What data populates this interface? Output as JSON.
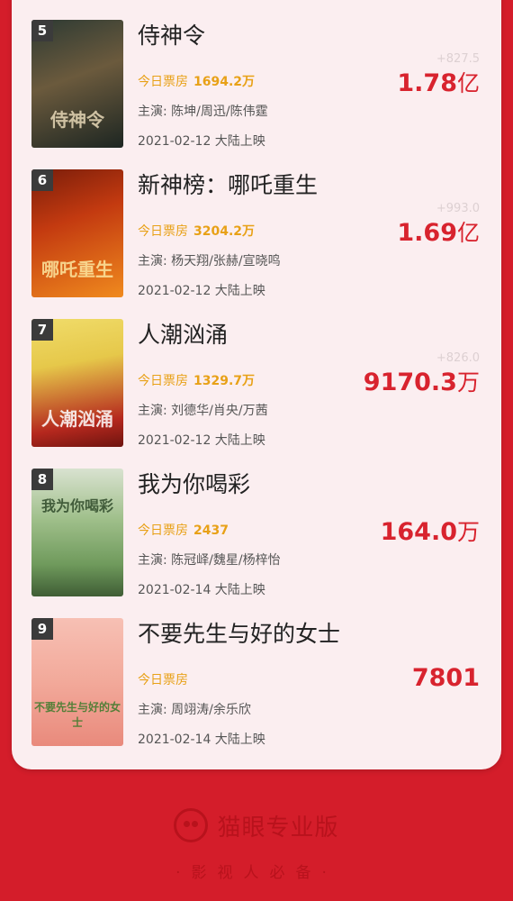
{
  "movies": [
    {
      "rank": "5",
      "title": "侍神令",
      "today_label": "今日票房",
      "today_value": "1694.2万",
      "cast": "主演: 陈坤/周迅/陈伟霆",
      "release": "2021-02-12 大陆上映",
      "total_value": "1.78",
      "total_unit": "亿",
      "prev_total": "+827.5",
      "poster_text": "侍神令",
      "poster_colors": [
        "#2d3a33",
        "#6b5a3d"
      ]
    },
    {
      "rank": "6",
      "title": "新神榜：哪吒重生",
      "today_label": "今日票房",
      "today_value": "3204.2万",
      "cast": "主演: 杨天翔/张赫/宣晓鸣",
      "release": "2021-02-12 大陆上映",
      "total_value": "1.69",
      "total_unit": "亿",
      "prev_total": "+993.0",
      "poster_text": "哪吒重生",
      "poster_colors": [
        "#c33a10",
        "#f08a1e"
      ]
    },
    {
      "rank": "7",
      "title": "人潮汹涌",
      "today_label": "今日票房",
      "today_value": "1329.7万",
      "cast": "主演: 刘德华/肖央/万茜",
      "release": "2021-02-12 大陆上映",
      "total_value": "9170.3",
      "total_unit": "万",
      "prev_total": "+826.0",
      "poster_text": "人潮汹涌",
      "poster_colors": [
        "#e6c84a",
        "#b5281e"
      ]
    },
    {
      "rank": "8",
      "title": "我为你喝彩",
      "today_label": "今日票房",
      "today_value": "2437",
      "cast": "主演: 陈冠峄/魏星/杨梓怡",
      "release": "2021-02-14 大陆上映",
      "total_value": "164.0",
      "total_unit": "万",
      "prev_total": "",
      "poster_text": "我为你喝彩",
      "poster_colors": [
        "#6f9a5c",
        "#d9e2d0"
      ]
    },
    {
      "rank": "9",
      "title": "不要先生与好的女士",
      "today_label": "今日票房",
      "today_value": "",
      "cast": "主演: 周翊涛/余乐欣",
      "release": "2021-02-14 大陆上映",
      "total_value": "7801",
      "total_unit": "",
      "prev_total": "",
      "poster_text": "不要先生与好的女士",
      "poster_colors": [
        "#f2a99a",
        "#e98a7c"
      ]
    }
  ],
  "footer": {
    "brand": "猫眼专业版",
    "slogan": "·影视人必备·"
  },
  "colors": {
    "accent": "#d8232e",
    "gold": "#e8a117",
    "background": "#d41d2a"
  }
}
